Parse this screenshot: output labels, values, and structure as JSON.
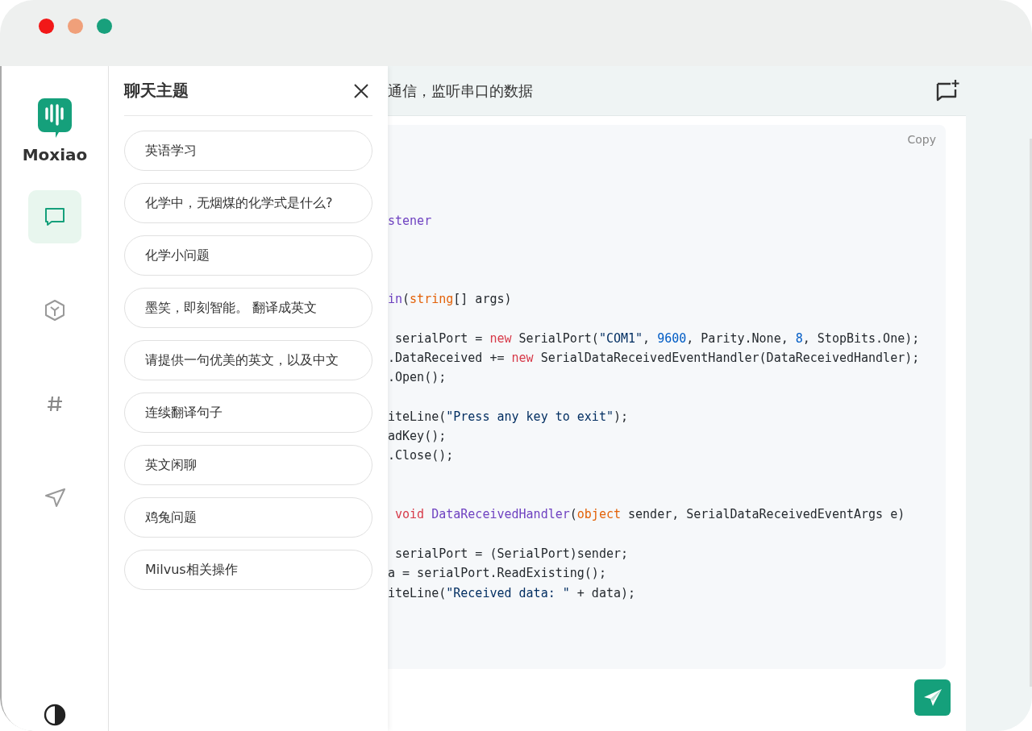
{
  "brand": {
    "name": "Moxiao"
  },
  "nav": [
    {
      "selected": true
    },
    {
      "selected": false
    },
    {
      "selected": false
    },
    {
      "selected": false
    }
  ],
  "drawer": {
    "title": "聊天主题",
    "topics": [
      {
        "label": "英语学习"
      },
      {
        "label": "化学中，无烟煤的化学式是什么?"
      },
      {
        "label": "化学小问题"
      },
      {
        "label": "墨笑，即刻智能。 翻译成英文"
      },
      {
        "label": "请提供一句优美的英文，以及中文"
      },
      {
        "label": "连续翻译句子"
      },
      {
        "label": "英文闲聊"
      },
      {
        "label": "鸡兔问题"
      },
      {
        "label": "Milvus相关操作"
      }
    ]
  },
  "chat": {
    "title": "通信，监听串口的数据",
    "code": {
      "copy_label": "Copy",
      "lines": [
        {
          "kind": "blank"
        },
        {
          "kind": "blank"
        },
        {
          "kind": "blank"
        },
        {
          "kind": "code",
          "segments": [
            {
              "kind": "method",
              "text": "stener"
            }
          ]
        },
        {
          "kind": "blank"
        },
        {
          "kind": "blank"
        },
        {
          "kind": "blank"
        },
        {
          "kind": "code",
          "segments": [
            {
              "kind": "method",
              "text": "in"
            },
            {
              "kind": "plain",
              "text": "("
            },
            {
              "kind": "type",
              "text": "string"
            },
            {
              "kind": "plain",
              "text": "[] args)"
            }
          ]
        },
        {
          "kind": "blank"
        },
        {
          "kind": "code",
          "segments": [
            {
              "kind": "plain",
              "text": " serialPort = "
            },
            {
              "kind": "keyword",
              "text": "new"
            },
            {
              "kind": "plain",
              "text": " SerialPort("
            },
            {
              "kind": "string",
              "text": "\"COM1\""
            },
            {
              "kind": "plain",
              "text": ", "
            },
            {
              "kind": "number",
              "text": "9600"
            },
            {
              "kind": "plain",
              "text": ", Parity.None, "
            },
            {
              "kind": "number",
              "text": "8"
            },
            {
              "kind": "plain",
              "text": ", StopBits.One);"
            }
          ]
        },
        {
          "kind": "code",
          "segments": [
            {
              "kind": "plain",
              "text": ".DataReceived += "
            },
            {
              "kind": "keyword",
              "text": "new"
            },
            {
              "kind": "plain",
              "text": " SerialDataReceivedEventHandler(DataReceivedHandler);"
            }
          ]
        },
        {
          "kind": "code",
          "segments": [
            {
              "kind": "plain",
              "text": ".Open();"
            }
          ]
        },
        {
          "kind": "blank"
        },
        {
          "kind": "code",
          "segments": [
            {
              "kind": "plain",
              "text": "iteLine("
            },
            {
              "kind": "string",
              "text": "\"Press any key to exit\""
            },
            {
              "kind": "plain",
              "text": ");"
            }
          ]
        },
        {
          "kind": "code",
          "segments": [
            {
              "kind": "plain",
              "text": "adKey();"
            }
          ]
        },
        {
          "kind": "code",
          "segments": [
            {
              "kind": "plain",
              "text": ".Close();"
            }
          ]
        },
        {
          "kind": "blank"
        },
        {
          "kind": "blank"
        },
        {
          "kind": "code",
          "segments": [
            {
              "kind": "keyword",
              "text": " void"
            },
            {
              "kind": "method",
              "text": " DataReceivedHandler"
            },
            {
              "kind": "plain",
              "text": "("
            },
            {
              "kind": "type",
              "text": "object"
            },
            {
              "kind": "plain",
              "text": " sender, SerialDataReceivedEventArgs e)"
            }
          ]
        },
        {
          "kind": "blank"
        },
        {
          "kind": "code",
          "segments": [
            {
              "kind": "plain",
              "text": " serialPort = (SerialPort)sender;"
            }
          ]
        },
        {
          "kind": "code",
          "segments": [
            {
              "kind": "plain",
              "text": "a = serialPort.ReadExisting();"
            }
          ]
        },
        {
          "kind": "code",
          "segments": [
            {
              "kind": "plain",
              "text": "iteLine("
            },
            {
              "kind": "string",
              "text": "\"Received data: \""
            },
            {
              "kind": "plain",
              "text": " + data);"
            }
          ]
        }
      ]
    }
  }
}
